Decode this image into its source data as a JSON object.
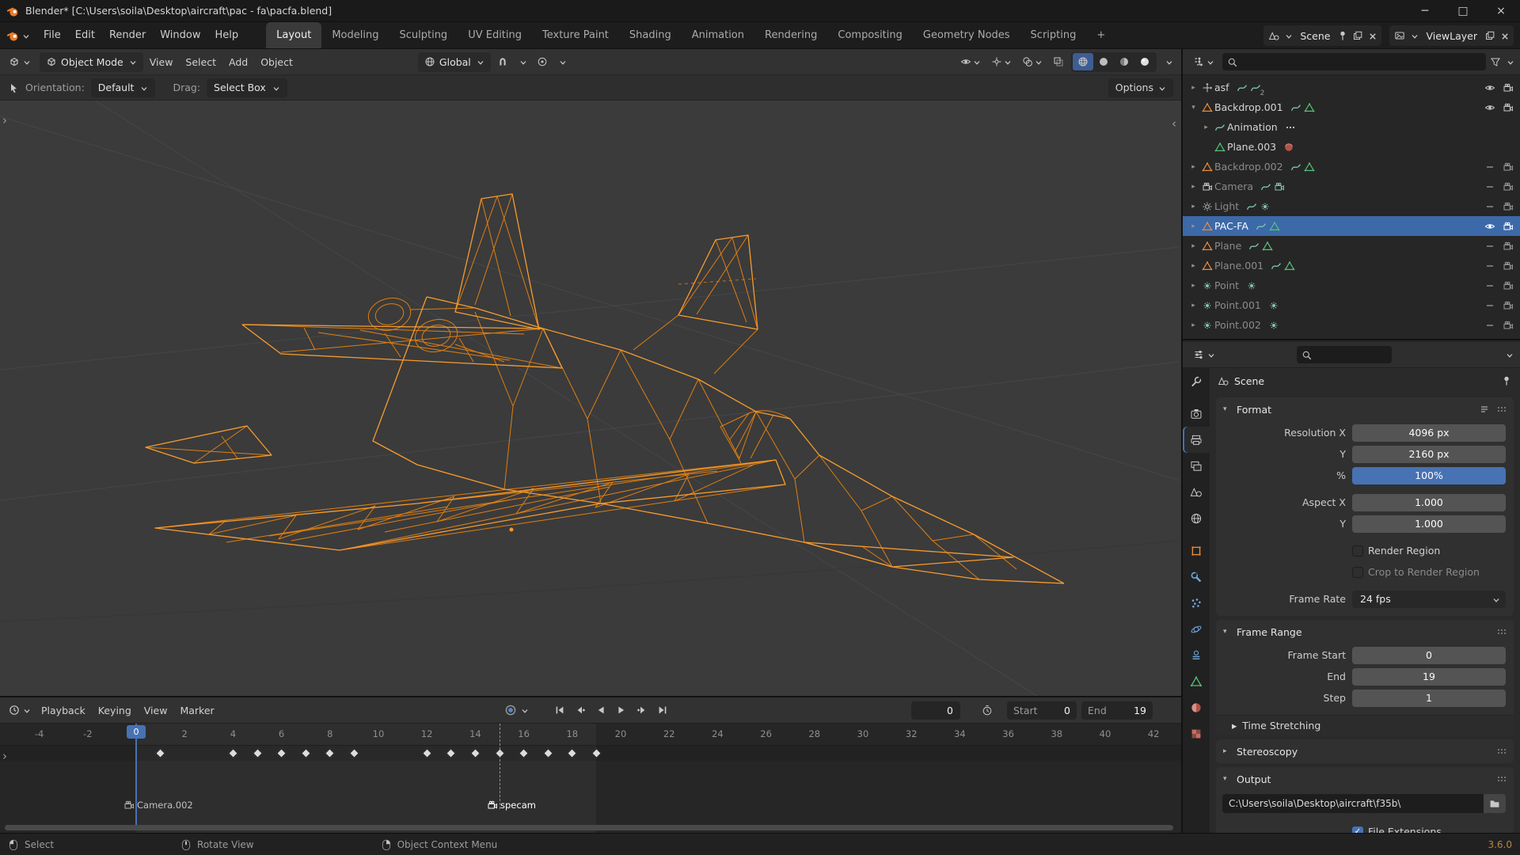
{
  "colors": {
    "accent": "#4772b3",
    "wire": "#f0901e"
  },
  "titlebar": {
    "title": "Blender* [C:\\Users\\soila\\Desktop\\aircraft\\pac - fa\\pacfa.blend]"
  },
  "menubar": {
    "menus": [
      "File",
      "Edit",
      "Render",
      "Window",
      "Help"
    ],
    "workspaces": [
      "Layout",
      "Modeling",
      "Sculpting",
      "UV Editing",
      "Texture Paint",
      "Shading",
      "Animation",
      "Rendering",
      "Compositing",
      "Geometry Nodes",
      "Scripting"
    ],
    "active_workspace": "Layout",
    "add_tab": "+",
    "scene_selector": {
      "label": "Scene"
    },
    "viewlayer_selector": {
      "label": "ViewLayer"
    }
  },
  "viewport": {
    "header": {
      "mode": "Object Mode",
      "menus": [
        "View",
        "Select",
        "Add",
        "Object"
      ],
      "orientation": "Global"
    },
    "tools": {
      "orientation_label": "Orientation:",
      "orientation_value": "Default",
      "drag_label": "Drag:",
      "drag_value": "Select Box",
      "options": "Options"
    }
  },
  "outliner": {
    "rows": [
      {
        "label": "asf",
        "depth": 0,
        "expand": "closed",
        "icon": "empty",
        "dim": false,
        "badges": [
          "anim",
          "anim2"
        ],
        "eye": "on",
        "cam": "on"
      },
      {
        "label": "Backdrop.001",
        "depth": 0,
        "expand": "open",
        "icon": "mesh",
        "dim": false,
        "badges": [
          "anim",
          "meshdata"
        ],
        "eye": "on",
        "cam": "on"
      },
      {
        "label": "Animation",
        "depth": 1,
        "expand": "closed",
        "icon": "anim",
        "dim": false,
        "badges": [
          "dots"
        ],
        "eye": "none",
        "cam": "none"
      },
      {
        "label": "Plane.003",
        "depth": 1,
        "icon": "meshdata",
        "dim": false,
        "badges": [
          "mat"
        ],
        "eye": "none",
        "cam": "none"
      },
      {
        "label": "Backdrop.002",
        "depth": 0,
        "expand": "closed",
        "icon": "mesh",
        "dim": true,
        "badges": [
          "anim",
          "meshdata"
        ],
        "eye": "off",
        "cam": "on"
      },
      {
        "label": "Camera",
        "depth": 0,
        "expand": "closed",
        "icon": "camera",
        "dim": true,
        "badges": [
          "anim",
          "camdata"
        ],
        "eye": "off",
        "cam": "on"
      },
      {
        "label": "Light",
        "depth": 0,
        "expand": "closed",
        "icon": "light",
        "dim": true,
        "badges": [
          "anim",
          "lightdata"
        ],
        "eye": "off",
        "cam": "on"
      },
      {
        "label": "PAC-FA",
        "depth": 0,
        "expand": "closed",
        "icon": "mesh",
        "dim": false,
        "selected": true,
        "badges": [
          "anim",
          "meshdata"
        ],
        "eye": "on",
        "cam": "on"
      },
      {
        "label": "Plane",
        "depth": 0,
        "expand": "closed",
        "icon": "mesh",
        "dim": true,
        "badges": [
          "anim",
          "meshdata"
        ],
        "eye": "off",
        "cam": "on"
      },
      {
        "label": "Plane.001",
        "depth": 0,
        "expand": "closed",
        "icon": "mesh",
        "dim": true,
        "badges": [
          "anim",
          "meshdata"
        ],
        "eye": "off",
        "cam": "on"
      },
      {
        "label": "Point",
        "depth": 0,
        "expand": "closed",
        "icon": "pointlight",
        "dim": true,
        "badges": [
          "lightdata"
        ],
        "eye": "off",
        "cam": "on"
      },
      {
        "label": "Point.001",
        "depth": 0,
        "expand": "closed",
        "icon": "pointlight",
        "dim": true,
        "badges": [
          "lightdata"
        ],
        "eye": "off",
        "cam": "on"
      },
      {
        "label": "Point.002",
        "depth": 0,
        "expand": "closed",
        "icon": "pointlight",
        "dim": true,
        "badges": [
          "lightdata"
        ],
        "eye": "off",
        "cam": "on"
      }
    ]
  },
  "properties": {
    "tabs": [
      {
        "name": "tool"
      },
      {
        "name": "render",
        "gap": true
      },
      {
        "name": "output",
        "active": true
      },
      {
        "name": "viewlayer"
      },
      {
        "name": "scene"
      },
      {
        "name": "world"
      },
      {
        "name": "object",
        "gap": true
      },
      {
        "name": "modifiers"
      },
      {
        "name": "particles"
      },
      {
        "name": "physics"
      },
      {
        "name": "constraints"
      },
      {
        "name": "data"
      },
      {
        "name": "material"
      },
      {
        "name": "texture"
      }
    ],
    "breadcrumb": "Scene",
    "panels": {
      "format": {
        "title": "Format",
        "rows": [
          {
            "type": "field",
            "label": "Resolution X",
            "value": "4096 px"
          },
          {
            "type": "field",
            "label": "Y",
            "value": "2160 px"
          },
          {
            "type": "slider",
            "label": "%",
            "value": "100%"
          },
          {
            "type": "field",
            "label": "Aspect X",
            "value": "1.000",
            "gap": true
          },
          {
            "type": "field",
            "label": "Y",
            "value": "1.000"
          },
          {
            "type": "checkbox",
            "label": "Render Region",
            "checked": false,
            "gap": true
          },
          {
            "type": "checkbox",
            "label": "Crop to Render Region",
            "checked": false,
            "dim": true
          },
          {
            "type": "dropdown",
            "label": "Frame Rate",
            "value": "24 fps",
            "gap": true
          }
        ]
      },
      "frame_range": {
        "title": "Frame Range",
        "rows": [
          {
            "type": "field",
            "label": "Frame Start",
            "value": "0"
          },
          {
            "type": "field",
            "label": "End",
            "value": "19"
          },
          {
            "type": "field",
            "label": "Step",
            "value": "1"
          }
        ],
        "subpanel": "Time Stretching"
      },
      "stereoscopy": {
        "title": "Stereoscopy"
      },
      "output": {
        "title": "Output",
        "path": "C:\\Users\\soila\\Desktop\\aircraft\\f35b\\",
        "partial_row": {
          "label": "File Extensions",
          "checked": true
        }
      }
    }
  },
  "timeline": {
    "menus": [
      "Playback",
      "Keying",
      "View",
      "Marker"
    ],
    "current_frame": "0",
    "start": {
      "label": "Start",
      "value": "0"
    },
    "end": {
      "label": "End",
      "value": "19"
    },
    "ruler": {
      "first": -4,
      "last": 42,
      "step": 2
    },
    "keyframes": [
      1,
      4,
      5,
      6,
      7,
      8,
      9,
      12,
      13,
      14,
      15,
      16,
      17,
      18,
      19
    ],
    "playhead": 0,
    "range": {
      "start": 0,
      "end": 19
    },
    "markers": [
      {
        "frame": 0,
        "label": "Camera.002",
        "selected": false
      },
      {
        "frame": 15,
        "label": "specam",
        "selected": true
      }
    ]
  },
  "statusbar": {
    "hints": [
      {
        "icon": "mouseleft",
        "label": "Select"
      },
      {
        "icon": "mousemid",
        "label": "Rotate View"
      },
      {
        "icon": "mouseright",
        "label": "Object Context Menu"
      }
    ],
    "version": "3.6.0"
  }
}
